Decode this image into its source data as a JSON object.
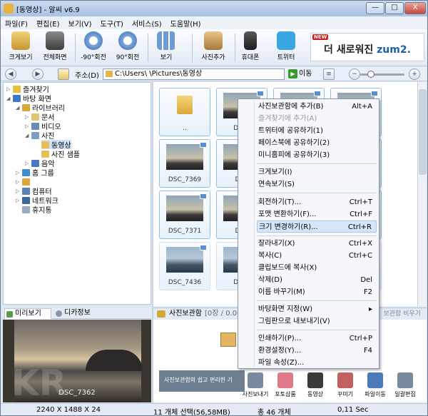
{
  "window": {
    "title": "[동영상] - 알씨 v6.9",
    "btn_min": "—",
    "btn_max": "□",
    "btn_close": "X"
  },
  "menubar": [
    "파일(F)",
    "편집(E)",
    "보기(V)",
    "도구(T)",
    "서비스(S)",
    "도움말(H)"
  ],
  "toolbar": {
    "b1": "크게보기",
    "b2": "전체화면",
    "b3": "-90°회전",
    "b4": "90°회전",
    "b5": "보기",
    "b6": "사진추가",
    "b7": "휴대폰",
    "b8": "트위터"
  },
  "zum": {
    "new": "NEW",
    "text": "더 새로워진 ",
    "brand": "zum",
    "suffix": "2."
  },
  "address": {
    "label": "주소(D)",
    "path": "C:\\Users\\          \\Pictures\\동영상",
    "go": "이동"
  },
  "tree": {
    "favorites": "즐겨찾기",
    "desktop": "바탕 화면",
    "libraries": "라이브러리",
    "documents": "문서",
    "video": "비디오",
    "pictures": "사진",
    "current": "동영상",
    "sample": "사진 샘플",
    "music": "음악",
    "homegroup": "홈 그룹",
    "user": "",
    "computer": "컴퓨터",
    "network": "네트워크",
    "trash": "휴지통"
  },
  "thumbs": [
    {
      "cap": ".."
    },
    {
      "cap": "DSC_"
    },
    {
      "cap": ""
    },
    {
      "cap": ""
    },
    {
      "cap": "DSC_7369"
    },
    {
      "cap": "DSC"
    },
    {
      "cap": ""
    },
    {
      "cap": ""
    },
    {
      "cap": "DSC_7371"
    },
    {
      "cap": "DSC"
    },
    {
      "cap": ""
    },
    {
      "cap": ""
    },
    {
      "cap": "DSC_7436"
    },
    {
      "cap": "DSC_"
    },
    {
      "cap": ""
    },
    {
      "cap": ""
    }
  ],
  "left_tabs": {
    "preview": "미리보기",
    "details": "디카정보"
  },
  "preview": {
    "caption": "DSC_7362",
    "watermark": "KR"
  },
  "album": {
    "title": "사진보관함",
    "status": "[0장 / 0.00B",
    "right": "보관함 비우기",
    "desc": "사진보관함의 쉽고 편리한 기"
  },
  "album_buttons": [
    "사진보내기",
    "포토샵룸",
    "동영상",
    "꾸미기",
    "파일이동",
    "일괄편집"
  ],
  "context_menu": [
    {
      "label": "사진보관함에 추가(B)",
      "key": "Alt+A"
    },
    {
      "label": "즐겨찾기에 추가(A)",
      "key": ""
    },
    {
      "label": "트위터에 공유하기(1)",
      "key": ""
    },
    {
      "label": "페이스북에 공유하기(2)",
      "key": ""
    },
    {
      "label": "미니홈피에 공유하기(3)",
      "key": ""
    },
    {
      "label": "크게보기(I)",
      "key": ""
    },
    {
      "label": "연속보기(S)",
      "key": ""
    },
    {
      "label": "회전하기(T)...",
      "key": "Ctrl+T"
    },
    {
      "label": "포맷 변환하기(F)...",
      "key": "Ctrl+F"
    },
    {
      "label": "크기 변경하기(R)...",
      "key": "Ctrl+R"
    },
    {
      "label": "잘라내기(X)",
      "key": "Ctrl+X"
    },
    {
      "label": "복사(C)",
      "key": "Ctrl+C"
    },
    {
      "label": "클립보드에 복사(X)",
      "key": ""
    },
    {
      "label": "삭제(D)",
      "key": "Del"
    },
    {
      "label": "이름 바꾸기(M)",
      "key": "F2"
    },
    {
      "label": "바탕화면 지정(W)",
      "key": "▸"
    },
    {
      "label": "그림판으로 내보내기(V)",
      "key": ""
    },
    {
      "label": "인쇄하기(P)...",
      "key": "Ctrl+P"
    },
    {
      "label": "환경설정(Y)...",
      "key": "F4"
    },
    {
      "label": "파일 속성(Z)...",
      "key": ""
    }
  ],
  "status": {
    "dims": "2240 X 1488 X 24",
    "selected": "11 개체 선택(56,58MB)",
    "total": "총 46 개체",
    "time": "0,11 Sec"
  },
  "colors": {
    "accent": "#1d5fa8",
    "selection": "#cde3f7",
    "highlight": "#d4e6f8"
  }
}
